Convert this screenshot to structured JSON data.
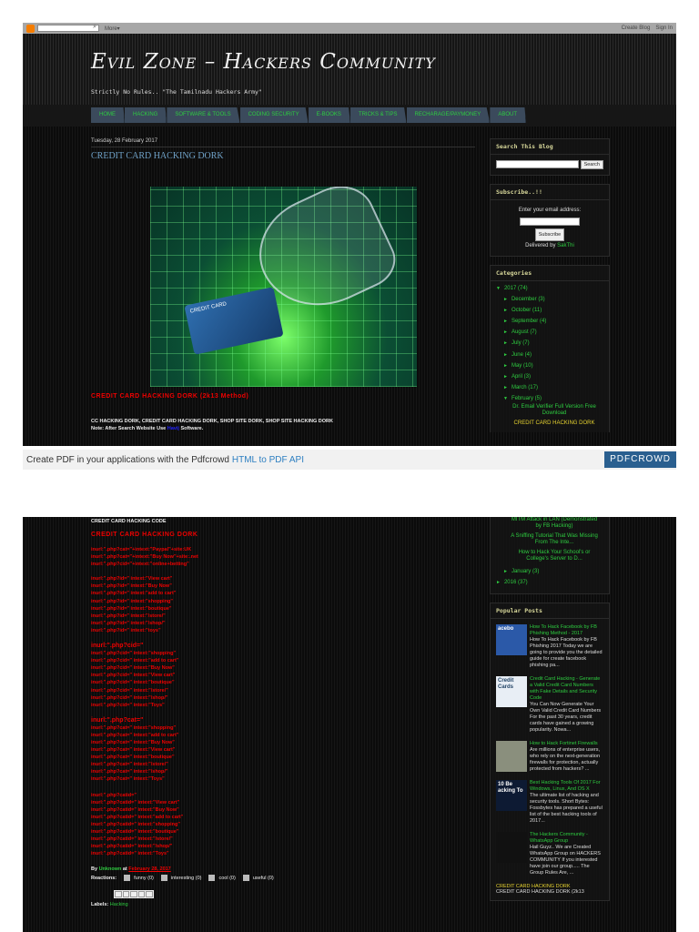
{
  "topbar": {
    "more": "More▾",
    "create_blog": "Create Blog",
    "sign_in": "Sign In"
  },
  "header": {
    "title": "Evil Zone – Hackers Community",
    "description": "Strictly No Rules.. \"The Tamilnadu Hackers Army\""
  },
  "nav": [
    "HOME",
    "HACKING",
    "SOFTWARE & TOOLS",
    "CODING SECURITY",
    "E-BOOKS",
    "TRICKS & TIPS",
    "RECHARAGE/PAYMONEY",
    "ABOUT"
  ],
  "post": {
    "date": "Tuesday, 28 February 2017",
    "title": "CREDIT CARD HACKING DORK",
    "image_card_text": "CREDIT CARD",
    "subtitle": "CREDIT CARD HACKING DORK (2k13 Method)",
    "keywords": "CC HACKING DORK, CREDIT CARD HACKING DORK, SHOP SITE DORK, SHOP SITE HACKING DORK",
    "note_prefix": "Note: After Search Website Use",
    "note_link": "Havij",
    "note_suffix": "Software.",
    "code_heading": "CREDIT CARD HACKING CODE",
    "code_subheading": "CREDIT CARD HACKING DORK",
    "group1": [
      "inurl:\".php?cat=\"+intext:\"Paypal\"+site:UK",
      "inurl:\".php?cat=\"+intext:\"Buy Now\"+site:.net",
      "inurl:\".php?cid=\"+intext:\"online+betting\""
    ],
    "group2": [
      "inurl:\".php?id=\" intext:\"View cart\"",
      "inurl:\".php?id=\" intext:\"Buy Now\"",
      "inurl:\".php?id=\" intext:\"add to cart\"",
      "inurl:\".php?id=\" intext:\"shopping\"",
      "inurl:\".php?id=\" intext:\"boutique\"",
      "inurl:\".php?id=\" intext:\"/store/\"",
      "inurl:\".php?id=\" intext:\"/shop/\"",
      "inurl:\".php?id=\" intext:\"toys\""
    ],
    "group3_heading": "inurl:\".php?cid=\"",
    "group3": [
      "inurl:\".php?cid=\" intext:\"shopping\"",
      "inurl:\".php?cid=\" intext:\"add to cart\"",
      "inurl:\".php?cid=\" intext:\"Buy Now\"",
      "inurl:\".php?cid=\" intext:\"View cart\"",
      "inurl:\".php?cid=\" intext:\"boutique\"",
      "inurl:\".php?cid=\" intext:\"/store/\"",
      "inurl:\".php?cid=\" intext:\"/shop/\"",
      "inurl:\".php?cid=\" intext:\"Toys\""
    ],
    "group4_heading": "inurl:\".php?cat=\"",
    "group4": [
      "inurl:\".php?cat=\" intext:\"shopping\"",
      "inurl:\".php?cat=\" intext:\"add to cart\"",
      "inurl:\".php?cat=\" intext:\"Buy Now\"",
      "inurl:\".php?cat=\" intext:\"View cart\"",
      "inurl:\".php?cat=\" intext:\"boutique\"",
      "inurl:\".php?cat=\" intext:\"/store/\"",
      "inurl:\".php?cat=\" intext:\"/shop/\"",
      "inurl:\".php?cat=\" intext:\"Toys\""
    ],
    "group5": [
      "inurl:\".php?catid=\"",
      "inurl:\".php?catid=\" intext:\"View cart\"",
      "inurl:\".php?catid=\" intext:\"Buy Now\"",
      "inurl:\".php?catid=\" intext:\"add to cart\"",
      "inurl:\".php?catid=\" intext:\"shopping\"",
      "inurl:\".php?catid=\" intext:\"boutique\"",
      "inurl:\".php?catid=\" intext:\"/store/\"",
      "inurl:\".php?catid=\" intext:\"/shop/\"",
      "inurl:\".php?catid=\" intext:\"Toys\""
    ],
    "by": "By",
    "author": "Unknown",
    "at": "at",
    "post_date": "February 28, 2017",
    "reactions_label": "Reactions:",
    "reactions": [
      "funny (0)",
      "interesting (0)",
      "cool (0)",
      "useful (0)"
    ],
    "labels_label": "Labels:",
    "label": "Hacking"
  },
  "sidebar": {
    "search_title": "Search This Blog",
    "search_button": "Search",
    "subscribe_title": "Subscribe..!!",
    "email_label": "Enter your email address:",
    "subscribe_button": "Subscribe",
    "delivered_by": "Delivered by",
    "delivered_link": "SakThi",
    "categories_title": "Categories",
    "year": "2017",
    "year_count": "(74)",
    "months": [
      [
        "December",
        "(3)"
      ],
      [
        "October",
        "(11)"
      ],
      [
        "September",
        "(4)"
      ],
      [
        "August",
        "(7)"
      ],
      [
        "July",
        "(7)"
      ],
      [
        "June",
        "(4)"
      ],
      [
        "May",
        "(10)"
      ],
      [
        "April",
        "(3)"
      ],
      [
        "March",
        "(17)"
      ]
    ],
    "feb": "February",
    "feb_count": "(5)",
    "feb_posts": [
      "Dr. Email Verifier Full Version Free Download"
    ],
    "current_post": "CREDIT CARD HACKING DORK",
    "feb_posts_2": [
      "MITM Attack in LAN (Demonstrated by FB Hacking)",
      "A Sniffing Tutorial That Was Missing From The Inte...",
      "How to Hack Your School's or College's Server to D..."
    ],
    "jan": "January",
    "jan_count": "(3)",
    "y2016": "2016",
    "y2016_count": "(37)",
    "popular_title": "Popular Posts",
    "popular": [
      {
        "title": "How To Hack Facebook by FB Phishing Method - 2017",
        "snippet": "How To Hack Facebook by FB Phishing 2017      Today we are going to provide you the detailed guide for create facebook phishing pa...",
        "thumb": "#2b59a8",
        "thumb_text": "acebo"
      },
      {
        "title": "Credit Card Hacking - Generate a Valid Credit Card Numbers with Fake Details and Security Code",
        "snippet": "You Can Now Generate Your Own Valid Credit Card Numbers For the past 30 years, credit cards have gained a growing popularity. Nowa...",
        "thumb": "#e8eef5",
        "thumb_text": "Credit Cards"
      },
      {
        "title": "How to Hack Fortinet Firewalls",
        "snippet": "Are millions of enterprise users, who rely on the next-generation firewalls for protection, actually protected from hackers? ...",
        "thumb": "#8a8f7d",
        "thumb_text": ""
      },
      {
        "title": "Best Hacking Tools Of 2017 For Windows, Linux, And OS X",
        "snippet": "The ultimate list of hacking and security tools. Short Bytes: Fossbytes has prepared a useful list of the best hacking tools of 2017...",
        "thumb": "#0d1a33",
        "thumb_text": "10 Be acking To"
      },
      {
        "title": "The Hackers Community - WhatsApp Group",
        "snippet": "Hail Guyz.. We are Created WhatsApp Group on HACKERS COMMUNITY If you interested have join our group..... The Group Rules Are, ...",
        "thumb": "#111",
        "thumb_text": ""
      }
    ],
    "last_title": "CREDIT CARD HACKING DORK",
    "last_snippet": "CREDIT CARD HACKING DORK (2k13"
  },
  "pdfcrowd": {
    "text": "Create PDF in your applications with the Pdfcrowd",
    "link": "HTML to PDF API",
    "button": "PDFCROWD"
  }
}
